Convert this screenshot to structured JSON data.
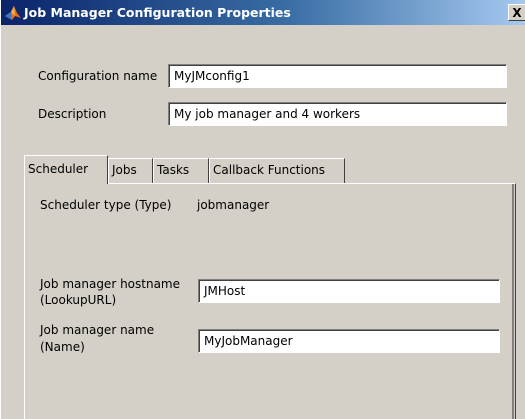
{
  "window": {
    "title": "Job Manager Configuration Properties",
    "close_label": "X",
    "accent": "#0a246a"
  },
  "form": {
    "config_name_label": "Configuration name",
    "config_name_value": "MyJMconfig1",
    "description_label": "Description",
    "description_value": "My job manager and 4 workers"
  },
  "tabs": [
    {
      "label": "Scheduler",
      "active": true
    },
    {
      "label": "Jobs",
      "active": false
    },
    {
      "label": "Tasks",
      "active": false
    },
    {
      "label": "Callback Functions",
      "active": false
    }
  ],
  "scheduler": {
    "type_label": "Scheduler type (Type)",
    "type_value": "jobmanager",
    "hostname_label_line1": "Job manager hostname",
    "hostname_label_line2": "(LookupURL)",
    "hostname_value": "JMHost",
    "name_label_line1": "Job manager name",
    "name_label_line2": "(Name)",
    "name_value": "MyJobManager"
  },
  "icons": {
    "app": "matlab-logo-icon",
    "close": "close-icon"
  }
}
